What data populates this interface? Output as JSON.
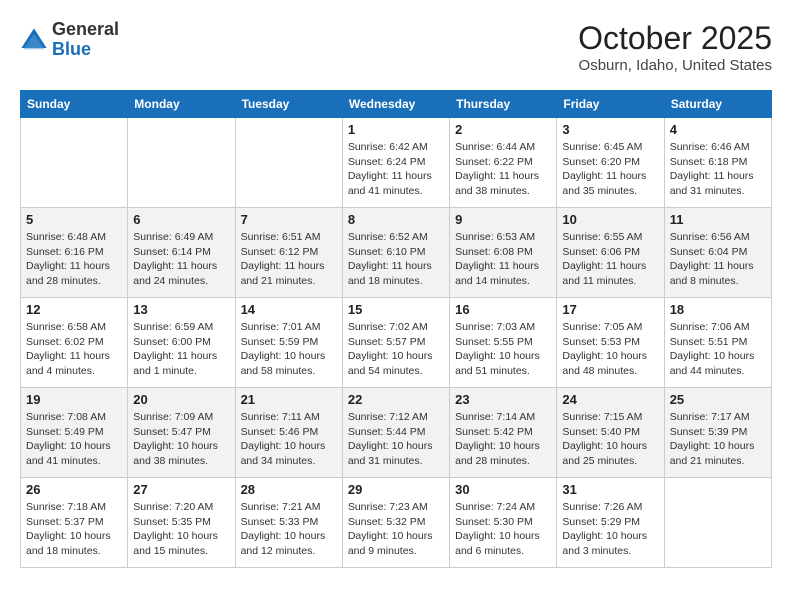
{
  "header": {
    "logo": {
      "general": "General",
      "blue": "Blue"
    },
    "title": "October 2025",
    "location": "Osburn, Idaho, United States"
  },
  "weekdays": [
    "Sunday",
    "Monday",
    "Tuesday",
    "Wednesday",
    "Thursday",
    "Friday",
    "Saturday"
  ],
  "weeks": [
    [
      null,
      null,
      null,
      {
        "day": 1,
        "sunrise": "6:42 AM",
        "sunset": "6:24 PM",
        "daylight": "11 hours and 41 minutes."
      },
      {
        "day": 2,
        "sunrise": "6:44 AM",
        "sunset": "6:22 PM",
        "daylight": "11 hours and 38 minutes."
      },
      {
        "day": 3,
        "sunrise": "6:45 AM",
        "sunset": "6:20 PM",
        "daylight": "11 hours and 35 minutes."
      },
      {
        "day": 4,
        "sunrise": "6:46 AM",
        "sunset": "6:18 PM",
        "daylight": "11 hours and 31 minutes."
      }
    ],
    [
      {
        "day": 5,
        "sunrise": "6:48 AM",
        "sunset": "6:16 PM",
        "daylight": "11 hours and 28 minutes."
      },
      {
        "day": 6,
        "sunrise": "6:49 AM",
        "sunset": "6:14 PM",
        "daylight": "11 hours and 24 minutes."
      },
      {
        "day": 7,
        "sunrise": "6:51 AM",
        "sunset": "6:12 PM",
        "daylight": "11 hours and 21 minutes."
      },
      {
        "day": 8,
        "sunrise": "6:52 AM",
        "sunset": "6:10 PM",
        "daylight": "11 hours and 18 minutes."
      },
      {
        "day": 9,
        "sunrise": "6:53 AM",
        "sunset": "6:08 PM",
        "daylight": "11 hours and 14 minutes."
      },
      {
        "day": 10,
        "sunrise": "6:55 AM",
        "sunset": "6:06 PM",
        "daylight": "11 hours and 11 minutes."
      },
      {
        "day": 11,
        "sunrise": "6:56 AM",
        "sunset": "6:04 PM",
        "daylight": "11 hours and 8 minutes."
      }
    ],
    [
      {
        "day": 12,
        "sunrise": "6:58 AM",
        "sunset": "6:02 PM",
        "daylight": "11 hours and 4 minutes."
      },
      {
        "day": 13,
        "sunrise": "6:59 AM",
        "sunset": "6:00 PM",
        "daylight": "11 hours and 1 minute."
      },
      {
        "day": 14,
        "sunrise": "7:01 AM",
        "sunset": "5:59 PM",
        "daylight": "10 hours and 58 minutes."
      },
      {
        "day": 15,
        "sunrise": "7:02 AM",
        "sunset": "5:57 PM",
        "daylight": "10 hours and 54 minutes."
      },
      {
        "day": 16,
        "sunrise": "7:03 AM",
        "sunset": "5:55 PM",
        "daylight": "10 hours and 51 minutes."
      },
      {
        "day": 17,
        "sunrise": "7:05 AM",
        "sunset": "5:53 PM",
        "daylight": "10 hours and 48 minutes."
      },
      {
        "day": 18,
        "sunrise": "7:06 AM",
        "sunset": "5:51 PM",
        "daylight": "10 hours and 44 minutes."
      }
    ],
    [
      {
        "day": 19,
        "sunrise": "7:08 AM",
        "sunset": "5:49 PM",
        "daylight": "10 hours and 41 minutes."
      },
      {
        "day": 20,
        "sunrise": "7:09 AM",
        "sunset": "5:47 PM",
        "daylight": "10 hours and 38 minutes."
      },
      {
        "day": 21,
        "sunrise": "7:11 AM",
        "sunset": "5:46 PM",
        "daylight": "10 hours and 34 minutes."
      },
      {
        "day": 22,
        "sunrise": "7:12 AM",
        "sunset": "5:44 PM",
        "daylight": "10 hours and 31 minutes."
      },
      {
        "day": 23,
        "sunrise": "7:14 AM",
        "sunset": "5:42 PM",
        "daylight": "10 hours and 28 minutes."
      },
      {
        "day": 24,
        "sunrise": "7:15 AM",
        "sunset": "5:40 PM",
        "daylight": "10 hours and 25 minutes."
      },
      {
        "day": 25,
        "sunrise": "7:17 AM",
        "sunset": "5:39 PM",
        "daylight": "10 hours and 21 minutes."
      }
    ],
    [
      {
        "day": 26,
        "sunrise": "7:18 AM",
        "sunset": "5:37 PM",
        "daylight": "10 hours and 18 minutes."
      },
      {
        "day": 27,
        "sunrise": "7:20 AM",
        "sunset": "5:35 PM",
        "daylight": "10 hours and 15 minutes."
      },
      {
        "day": 28,
        "sunrise": "7:21 AM",
        "sunset": "5:33 PM",
        "daylight": "10 hours and 12 minutes."
      },
      {
        "day": 29,
        "sunrise": "7:23 AM",
        "sunset": "5:32 PM",
        "daylight": "10 hours and 9 minutes."
      },
      {
        "day": 30,
        "sunrise": "7:24 AM",
        "sunset": "5:30 PM",
        "daylight": "10 hours and 6 minutes."
      },
      {
        "day": 31,
        "sunrise": "7:26 AM",
        "sunset": "5:29 PM",
        "daylight": "10 hours and 3 minutes."
      },
      null
    ]
  ]
}
